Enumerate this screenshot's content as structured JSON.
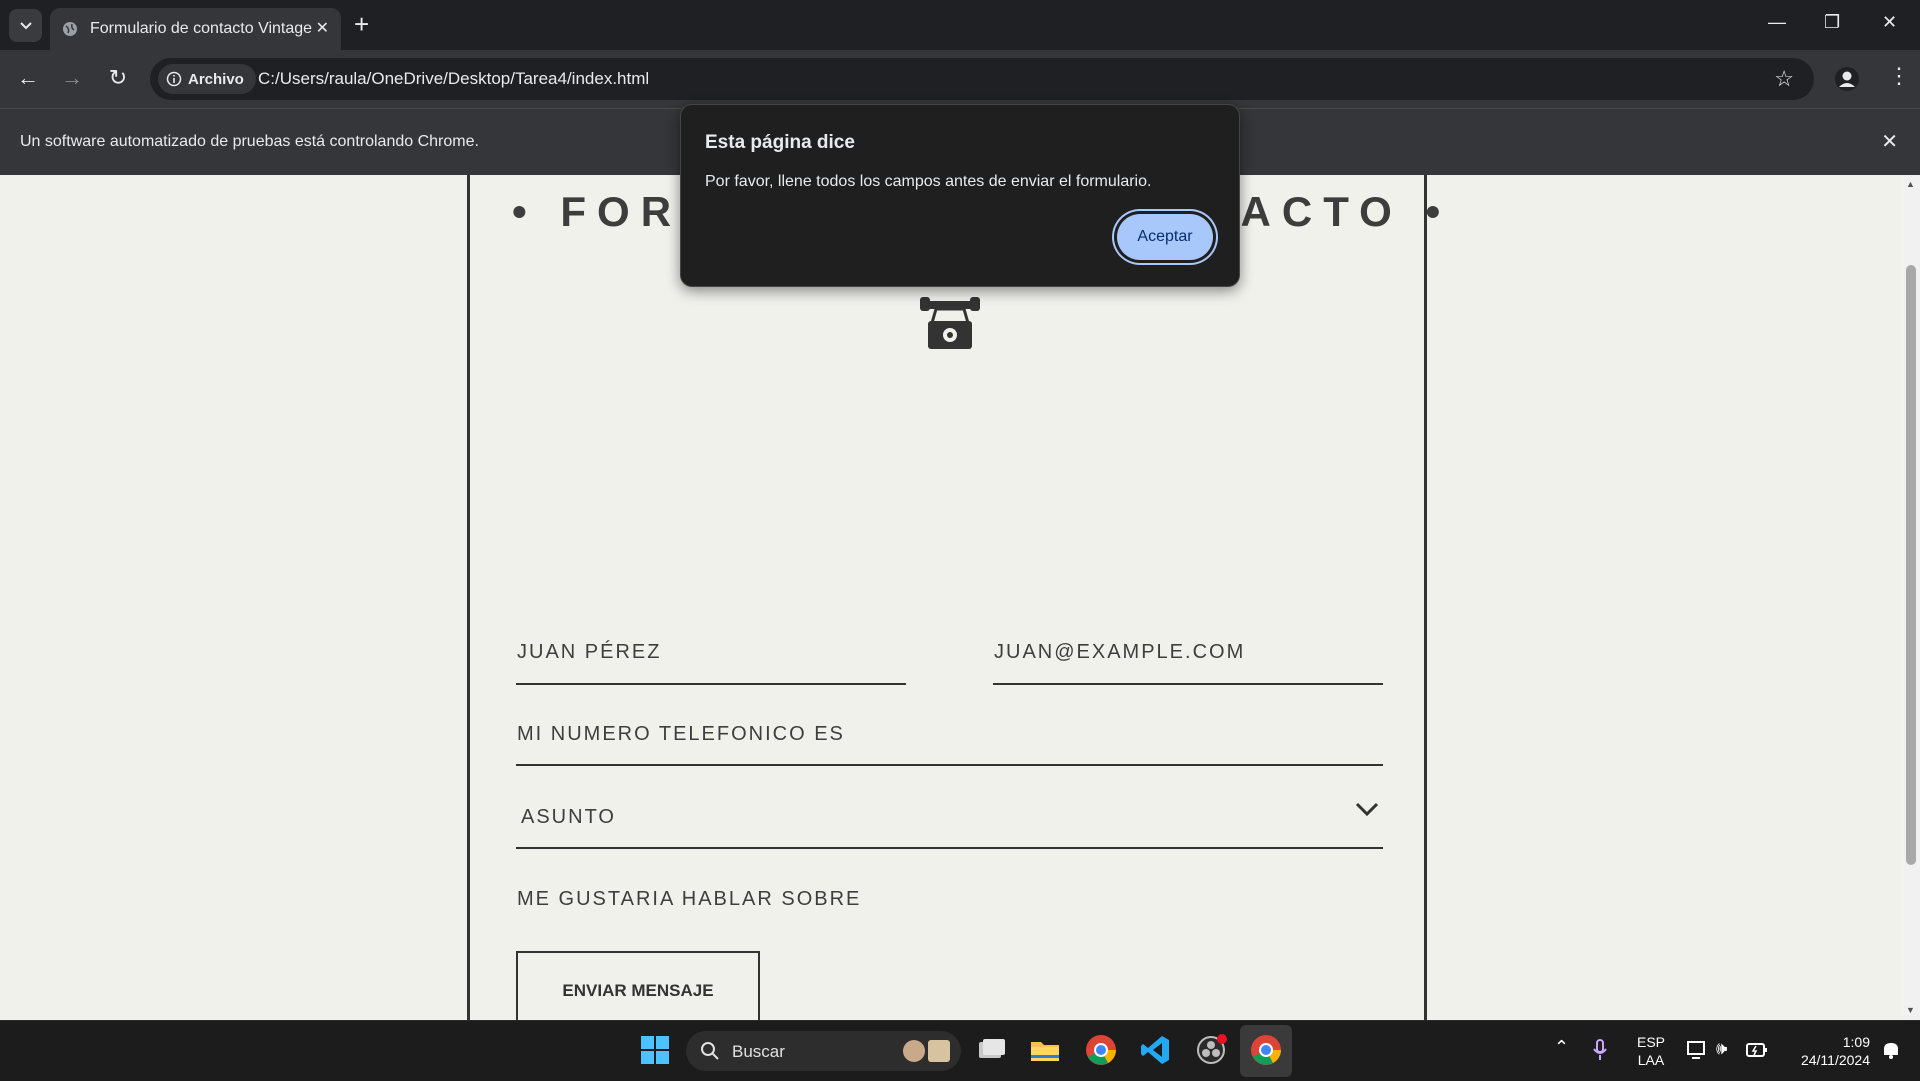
{
  "browser": {
    "tab_title": "Formulario de contacto Vintage",
    "site_chip": "Archivo",
    "url": "C:/Users/raula/OneDrive/Desktop/Tarea4/index.html",
    "infobar_text": "Un software automatizado de pruebas está controlando Chrome."
  },
  "page": {
    "form_title": "• FORMULARIO DE CONTACTO •",
    "name_placeholder": "JUAN PÉREZ",
    "email_placeholder": "JUAN@EXAMPLE.COM",
    "phone_placeholder": "MI NUMERO TELEFONICO ES",
    "subject_placeholder": "ASUNTO",
    "message_placeholder": "ME GUSTARIA HABLAR SOBRE",
    "submit_label": "ENVIAR MENSAJE"
  },
  "dialog": {
    "title": "Esta página dice",
    "message": "Por favor, llene todos los campos antes de enviar el formulario.",
    "accept_label": "Aceptar"
  },
  "taskbar": {
    "search_label": "Buscar",
    "lang_top": "ESP",
    "lang_bottom": "LAA",
    "time": "1:09",
    "date": "24/11/2024"
  },
  "colors": {
    "page_bg": "#f1f1ec",
    "dialog_button": "#a8c7fa"
  }
}
